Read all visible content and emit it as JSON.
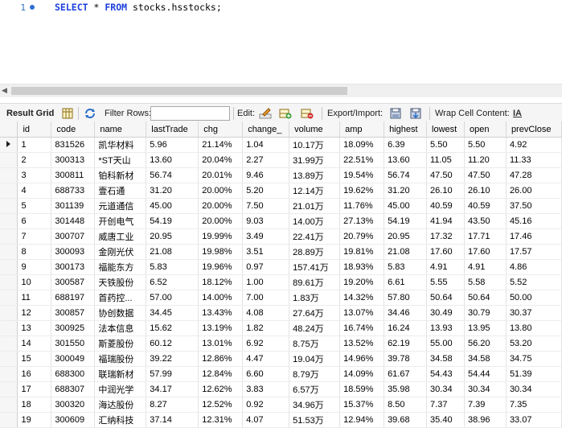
{
  "editor": {
    "line_number": "1",
    "sql": {
      "kw1": "SELECT",
      "star": "*",
      "kw2": "FROM",
      "table": "stocks.hsstocks;"
    }
  },
  "toolbar": {
    "result_grid_label": "Result Grid",
    "filter_rows_label": "Filter Rows:",
    "filter_rows_value": "",
    "edit_label": "Edit:",
    "export_import_label": "Export/Import:",
    "wrap_cell_label": "Wrap Cell Content:",
    "wrap_icon_text": "IA"
  },
  "grid": {
    "columns": [
      "id",
      "code",
      "name",
      "lastTrade",
      "chg",
      "change_",
      "volume",
      "amp",
      "highest",
      "lowest",
      "open",
      "prevClose"
    ],
    "rows": [
      [
        "1",
        "831526",
        "凯华材料",
        "5.96",
        "21.14%",
        "1.04",
        "10.17万",
        "18.09%",
        "6.39",
        "5.50",
        "5.50",
        "4.92"
      ],
      [
        "2",
        "300313",
        "*ST天山",
        "13.60",
        "20.04%",
        "2.27",
        "31.99万",
        "22.51%",
        "13.60",
        "11.05",
        "11.20",
        "11.33"
      ],
      [
        "3",
        "300811",
        "铂科新材",
        "56.74",
        "20.01%",
        "9.46",
        "13.89万",
        "19.54%",
        "56.74",
        "47.50",
        "47.50",
        "47.28"
      ],
      [
        "4",
        "688733",
        "壹石通",
        "31.20",
        "20.00%",
        "5.20",
        "12.14万",
        "19.62%",
        "31.20",
        "26.10",
        "26.10",
        "26.00"
      ],
      [
        "5",
        "301139",
        "元道通信",
        "45.00",
        "20.00%",
        "7.50",
        "21.01万",
        "11.76%",
        "45.00",
        "40.59",
        "40.59",
        "37.50"
      ],
      [
        "6",
        "301448",
        "开创电气",
        "54.19",
        "20.00%",
        "9.03",
        "14.00万",
        "27.13%",
        "54.19",
        "41.94",
        "43.50",
        "45.16"
      ],
      [
        "7",
        "300707",
        "威唐工业",
        "20.95",
        "19.99%",
        "3.49",
        "22.41万",
        "20.79%",
        "20.95",
        "17.32",
        "17.71",
        "17.46"
      ],
      [
        "8",
        "300093",
        "金刚光伏",
        "21.08",
        "19.98%",
        "3.51",
        "28.89万",
        "19.81%",
        "21.08",
        "17.60",
        "17.60",
        "17.57"
      ],
      [
        "9",
        "300173",
        "福能东方",
        "5.83",
        "19.96%",
        "0.97",
        "157.41万",
        "18.93%",
        "5.83",
        "4.91",
        "4.91",
        "4.86"
      ],
      [
        "10",
        "300587",
        "天铁股份",
        "6.52",
        "18.12%",
        "1.00",
        "89.61万",
        "19.20%",
        "6.61",
        "5.55",
        "5.58",
        "5.52"
      ],
      [
        "11",
        "688197",
        "首药控...",
        "57.00",
        "14.00%",
        "7.00",
        "1.83万",
        "14.32%",
        "57.80",
        "50.64",
        "50.64",
        "50.00"
      ],
      [
        "12",
        "300857",
        "协创数据",
        "34.45",
        "13.43%",
        "4.08",
        "27.64万",
        "13.07%",
        "34.46",
        "30.49",
        "30.79",
        "30.37"
      ],
      [
        "13",
        "300925",
        "法本信息",
        "15.62",
        "13.19%",
        "1.82",
        "48.24万",
        "16.74%",
        "16.24",
        "13.93",
        "13.95",
        "13.80"
      ],
      [
        "14",
        "301550",
        "斯菱股份",
        "60.12",
        "13.01%",
        "6.92",
        "8.75万",
        "13.52%",
        "62.19",
        "55.00",
        "56.20",
        "53.20"
      ],
      [
        "15",
        "300049",
        "福瑞股份",
        "39.22",
        "12.86%",
        "4.47",
        "19.04万",
        "14.96%",
        "39.78",
        "34.58",
        "34.58",
        "34.75"
      ],
      [
        "16",
        "688300",
        "联瑞新材",
        "57.99",
        "12.84%",
        "6.60",
        "8.79万",
        "14.09%",
        "61.67",
        "54.43",
        "54.44",
        "51.39"
      ],
      [
        "17",
        "688307",
        "中润光学",
        "34.17",
        "12.62%",
        "3.83",
        "6.57万",
        "18.59%",
        "35.98",
        "30.34",
        "30.34",
        "30.34"
      ],
      [
        "18",
        "300320",
        "海达股份",
        "8.27",
        "12.52%",
        "0.92",
        "34.96万",
        "15.37%",
        "8.50",
        "7.37",
        "7.39",
        "7.35"
      ],
      [
        "19",
        "300609",
        "汇纳科技",
        "37.14",
        "12.31%",
        "4.07",
        "51.53万",
        "12.94%",
        "39.68",
        "35.40",
        "38.96",
        "33.07"
      ]
    ]
  }
}
